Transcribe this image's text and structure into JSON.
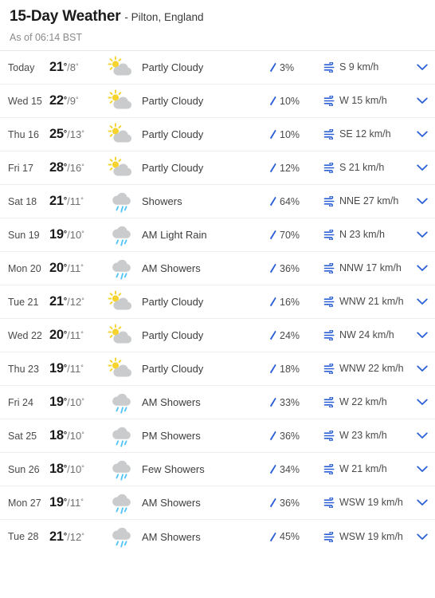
{
  "header": {
    "title_main": "15-Day Weather",
    "title_sub": "- Pilton, England",
    "as_of": "As of 06:14 BST"
  },
  "colors": {
    "accent_blue": "#2a5fd6",
    "rain_blue": "#4fc3f7",
    "cloud_gray": "#c9cbcd",
    "sun_yellow": "#f6d32d",
    "divider": "#ededed",
    "text_dark": "#1b1b1b",
    "text_muted": "#6f6f6f"
  },
  "icons": {
    "precip": "raindrop-icon",
    "wind": "wind-icon",
    "expand": "chevron-down-icon",
    "partly_cloudy": "partly-cloudy-icon",
    "showers": "showers-icon"
  },
  "rows": [
    {
      "day": "Today",
      "hi": "21",
      "lo": "8",
      "cond": "Partly Cloudy",
      "icon": "partly-cloudy",
      "precip": "3%",
      "wind": "S 9 km/h"
    },
    {
      "day": "Wed 15",
      "hi": "22",
      "lo": "9",
      "cond": "Partly Cloudy",
      "icon": "partly-cloudy",
      "precip": "10%",
      "wind": "W 15 km/h"
    },
    {
      "day": "Thu 16",
      "hi": "25",
      "lo": "13",
      "cond": "Partly Cloudy",
      "icon": "partly-cloudy",
      "precip": "10%",
      "wind": "SE 12 km/h"
    },
    {
      "day": "Fri 17",
      "hi": "28",
      "lo": "16",
      "cond": "Partly Cloudy",
      "icon": "partly-cloudy",
      "precip": "12%",
      "wind": "S 21 km/h"
    },
    {
      "day": "Sat 18",
      "hi": "21",
      "lo": "11",
      "cond": "Showers",
      "icon": "showers",
      "precip": "64%",
      "wind": "NNE 27 km/h"
    },
    {
      "day": "Sun 19",
      "hi": "19",
      "lo": "10",
      "cond": "AM Light Rain",
      "icon": "showers",
      "precip": "70%",
      "wind": "N 23 km/h"
    },
    {
      "day": "Mon 20",
      "hi": "20",
      "lo": "11",
      "cond": "AM Showers",
      "icon": "showers",
      "precip": "36%",
      "wind": "NNW 17 km/h"
    },
    {
      "day": "Tue 21",
      "hi": "21",
      "lo": "12",
      "cond": "Partly Cloudy",
      "icon": "partly-cloudy",
      "precip": "16%",
      "wind": "WNW 21 km/h"
    },
    {
      "day": "Wed 22",
      "hi": "20",
      "lo": "11",
      "cond": "Partly Cloudy",
      "icon": "partly-cloudy",
      "precip": "24%",
      "wind": "NW 24 km/h"
    },
    {
      "day": "Thu 23",
      "hi": "19",
      "lo": "11",
      "cond": "Partly Cloudy",
      "icon": "partly-cloudy",
      "precip": "18%",
      "wind": "WNW 22 km/h"
    },
    {
      "day": "Fri 24",
      "hi": "19",
      "lo": "10",
      "cond": "AM Showers",
      "icon": "showers",
      "precip": "33%",
      "wind": "W 22 km/h"
    },
    {
      "day": "Sat 25",
      "hi": "18",
      "lo": "10",
      "cond": "PM Showers",
      "icon": "showers",
      "precip": "36%",
      "wind": "W 23 km/h"
    },
    {
      "day": "Sun 26",
      "hi": "18",
      "lo": "10",
      "cond": "Few Showers",
      "icon": "showers",
      "precip": "34%",
      "wind": "W 21 km/h"
    },
    {
      "day": "Mon 27",
      "hi": "19",
      "lo": "11",
      "cond": "AM Showers",
      "icon": "showers",
      "precip": "36%",
      "wind": "WSW 19 km/h"
    },
    {
      "day": "Tue 28",
      "hi": "21",
      "lo": "12",
      "cond": "AM Showers",
      "icon": "showers",
      "precip": "45%",
      "wind": "WSW 19 km/h"
    }
  ]
}
